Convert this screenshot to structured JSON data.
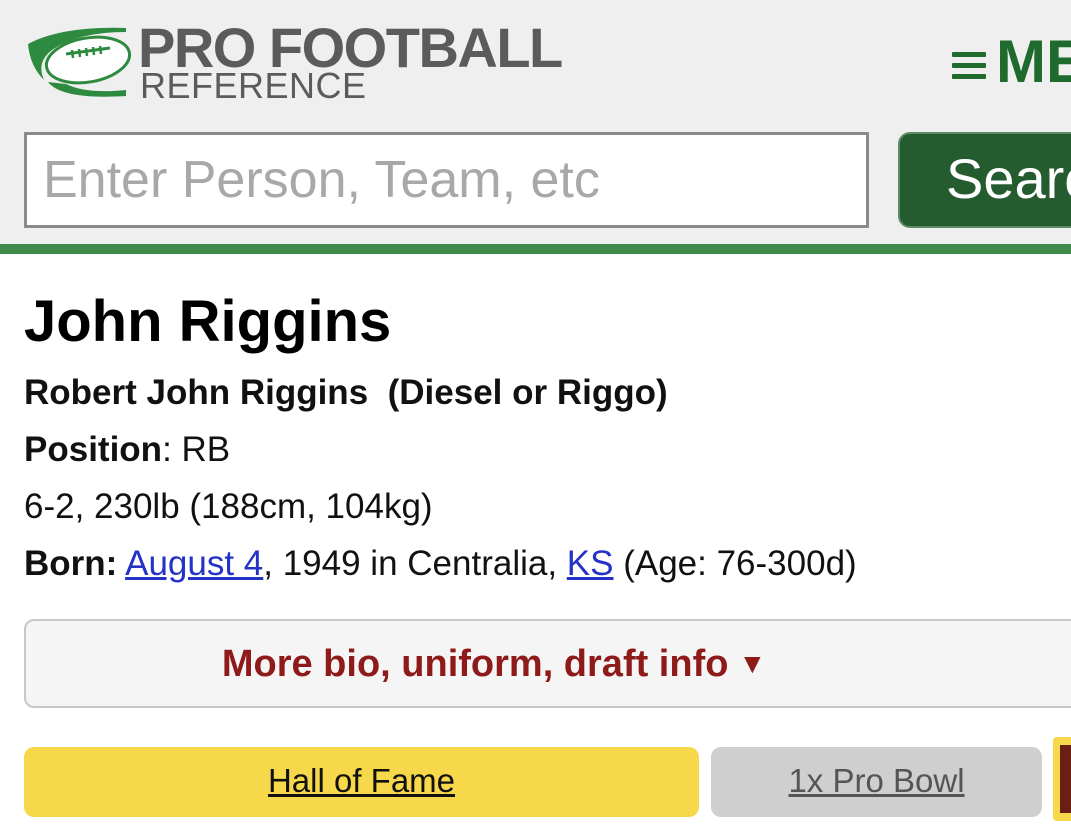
{
  "header": {
    "logo_line1": "PRO FOOTBALL",
    "logo_line2": "REFERENCE",
    "menu_label": "ME",
    "brand_color": "#1f6b2e"
  },
  "search": {
    "placeholder": "Enter Person, Team, etc",
    "value": "",
    "button_label": "Searc"
  },
  "player": {
    "name": "John Riggins",
    "full_name": "Robert John Riggins",
    "nicknames": "(Diesel or Riggo)",
    "position_label": "Position",
    "position_value": "RB",
    "measurements": "6-2, 230lb (188cm, 104kg)",
    "born_label": "Born:",
    "born_date_link": "August 4",
    "born_year_place": ", 1949 in Centralia, ",
    "born_state_link": "KS",
    "age_text": " (Age: 76-300d)"
  },
  "more_bio": {
    "label": "More bio, uniform, draft info",
    "arrow": "▼"
  },
  "badges": [
    {
      "label": "Hall of Fame",
      "color": "#f6d84a"
    },
    {
      "label": "1x Pro Bowl",
      "color": "#cfcfcf"
    }
  ]
}
